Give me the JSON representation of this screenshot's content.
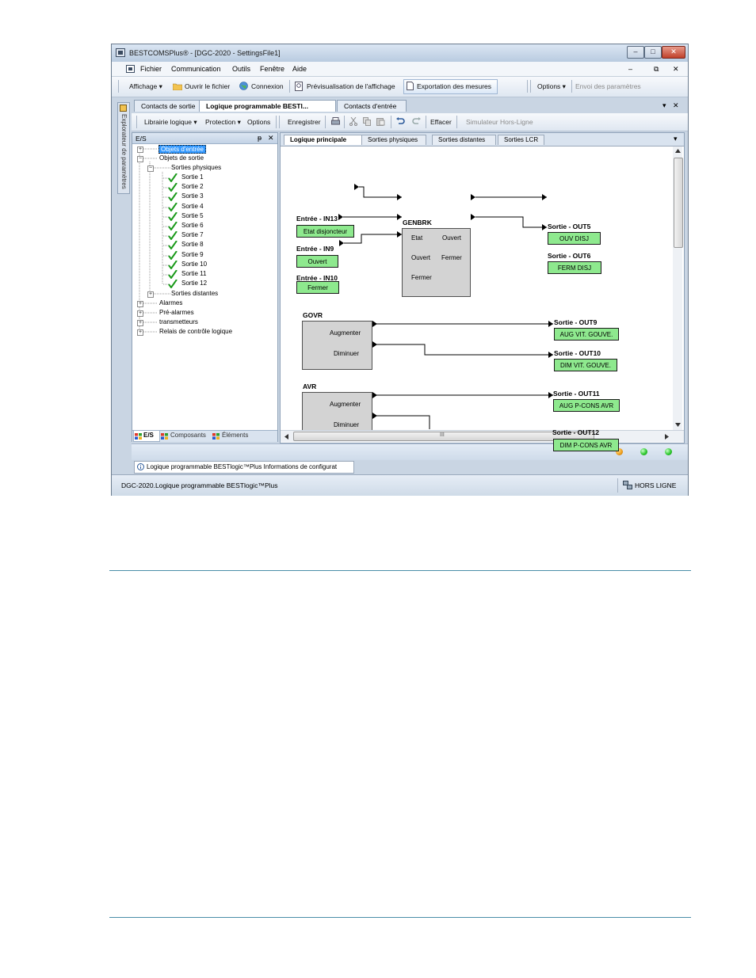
{
  "window": {
    "title": "BESTCOMSPlus® - [DGC-2020 - SettingsFile1]",
    "min": "–",
    "max": "□",
    "close": "✕"
  },
  "menu": {
    "items": [
      "Fichier",
      "Communication",
      "Outils",
      "Fenêtre",
      "Aide"
    ],
    "mdi_min": "–",
    "mdi_restore": "⧉",
    "mdi_close": "✕"
  },
  "toolbar": {
    "affichage": "Affichage ▾",
    "open": "Ouvrir le fichier",
    "connect": "Connexion",
    "preview": "Prévisualisation de l'affichage",
    "export": "Exportation des mesures",
    "options": "Options ▾",
    "send": "Envoi des paramètres"
  },
  "doc_tabs": {
    "t1": "Contacts de sortie",
    "t2": "Logique programmable BESTl...",
    "t3": "Contacts d'entrée",
    "menu": "▾",
    "close": "✕"
  },
  "side_panel": {
    "label": "Explorateur de paramètres"
  },
  "logic_toolbar": {
    "library": "Librairie logique ▾",
    "protection": "Protection ▾",
    "options": "Options",
    "save": "Enregistrer",
    "clear": "Effacer",
    "simulator": "Simulateur Hors-Ligne"
  },
  "tree_panel": {
    "header": "E/S",
    "pin": "ᵽ",
    "close": "✕",
    "nodes": {
      "inputs": "Objets d'entrée",
      "outputs": "Objets de sortie",
      "physical": "Sorties physiques",
      "remote": "Sorties distantes",
      "alarms": "Alarmes",
      "prealarms": "Pré-alarmes",
      "transmitters": "transmetteurs",
      "relays": "Relais de contrôle logique"
    },
    "sorties": [
      "Sortie 1",
      "Sortie 2",
      "Sortie 3",
      "Sortie 4",
      "Sortie 5",
      "Sortie 6",
      "Sortie 7",
      "Sortie 8",
      "Sortie 9",
      "Sortie 10",
      "Sortie 11",
      "Sortie 12"
    ],
    "bottom_tabs": [
      "E/S",
      "Composants",
      "Éléments"
    ]
  },
  "canvas_tabs": {
    "tabs": [
      "Logique principale",
      "Sorties physiques",
      "Sorties distantes",
      "Sorties LCR"
    ],
    "menu": "▾"
  },
  "diagram": {
    "in13_label": "Entrée - IN13",
    "in13_box": "Etat disjoncteur",
    "in9_label": "Entrée - IN9",
    "in9_box": "Ouvert",
    "in10_label": "Entrée - IN10",
    "in10_box": "Fermer",
    "genbrk": "GENBRK",
    "genbrk_in": [
      "Etat",
      "Ouvert",
      "Fermer"
    ],
    "genbrk_out": [
      "Ouvert",
      "Fermer"
    ],
    "out5_label": "Sortie - OUT5",
    "out5_box": "OUV DISJ",
    "out6_label": "Sortie - OUT6",
    "out6_box": "FERM DISJ",
    "govr": "GOVR",
    "govr_out": [
      "Augmenter",
      "Diminuer"
    ],
    "out9_label": "Sortie - OUT9",
    "out9_box": "AUG VIT. GOUVE.",
    "out10_label": "Sortie - OUT10",
    "out10_box": "DIM VIT. GOUVE.",
    "avr": "AVR",
    "avr_out": [
      "Augmenter",
      "Diminuer"
    ],
    "out11_label": "Sortie - OUT11",
    "out11_box": "AUG P-CONS AVR",
    "out12_label": "Sortie - OUT12",
    "out12_box": "DIM P-CONS AVR"
  },
  "hscroll_grip": "III",
  "info_tab": "Logique programmable BESTlogic™Plus Informations de configurat",
  "status": {
    "left": "DGC-2020.Logique programmable BESTlogic™Plus",
    "right": "HORS LIGNE"
  },
  "colors": {
    "accent": "#4a8ea8",
    "logic_box": "#8ee98e",
    "led_orange": "#f0a020",
    "led_green": "#2fc82f"
  }
}
